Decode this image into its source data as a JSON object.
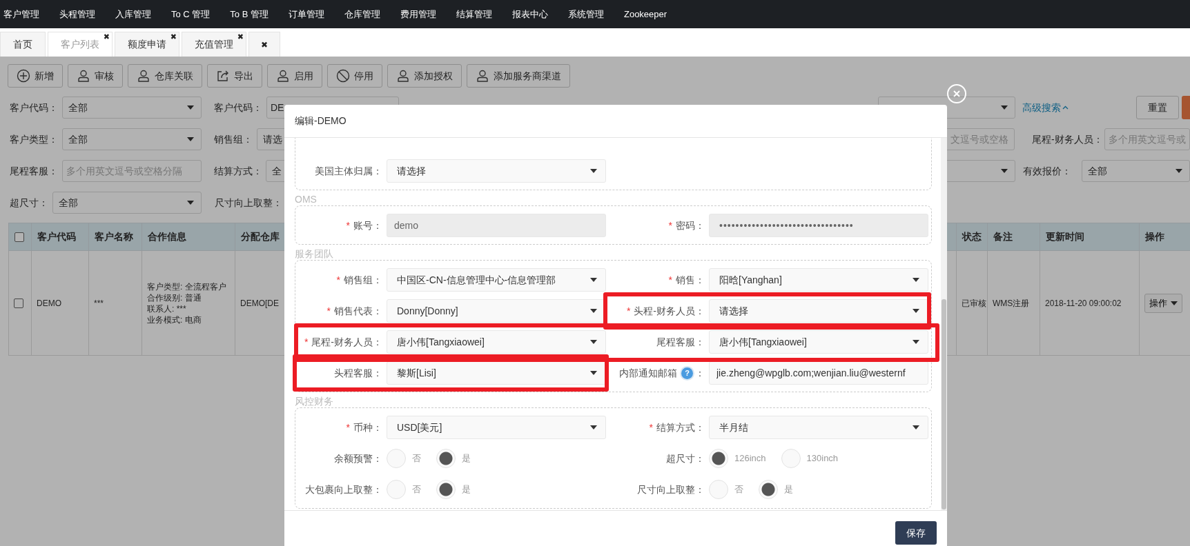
{
  "nav": {
    "items": [
      "客户管理",
      "头程管理",
      "入库管理",
      "To C 管理",
      "To B 管理",
      "订单管理",
      "仓库管理",
      "费用管理",
      "结算管理",
      "报表中心",
      "系统管理",
      "Zookeeper"
    ]
  },
  "tabs": [
    {
      "label": "首页",
      "selected": false
    },
    {
      "label": "客户列表",
      "selected": true,
      "close": "✖"
    },
    {
      "label": "额度申请",
      "selected": false,
      "close": "✖"
    },
    {
      "label": "充值管理",
      "selected": false,
      "close": "✖"
    },
    {
      "close": "✖",
      "selected": false
    }
  ],
  "toolbar": [
    {
      "kind": "add",
      "label": "新增"
    },
    {
      "kind": "approve",
      "label": "审核"
    },
    {
      "kind": "link",
      "label": "仓库关联"
    },
    {
      "kind": "export",
      "label": "导出"
    },
    {
      "kind": "enable",
      "label": "启用"
    },
    {
      "kind": "disable",
      "label": "停用"
    },
    {
      "kind": "authorize",
      "label": "添加授权"
    },
    {
      "kind": "channel",
      "label": "添加服务商渠道"
    }
  ],
  "filters": [
    {
      "left": [
        {
          "kind": "label",
          "text": "客户代码："
        },
        {
          "kind": "select",
          "value": "全部"
        },
        {
          "kind": "label",
          "text": "客户代码："
        },
        {
          "kind": "input",
          "value": "DE"
        }
      ],
      "right": [
        {
          "kind": "select"
        },
        {
          "kind": "link",
          "text": "高级搜索"
        },
        {
          "kind": "button",
          "label": "重置"
        },
        {
          "kind": "primary"
        }
      ]
    },
    {
      "left": [
        {
          "kind": "label",
          "text": "客户类型："
        },
        {
          "kind": "select",
          "value": "全部"
        },
        {
          "kind": "label",
          "text": "销售组："
        },
        {
          "kind": "select",
          "value": "请选"
        }
      ],
      "right": [
        {
          "kind": "input",
          "placeholder": "文逗号或空格"
        },
        {
          "kind": "label",
          "text": "尾程-财务人员："
        },
        {
          "kind": "input",
          "placeholder": "多个用英文逗号或"
        }
      ]
    },
    {
      "left": [
        {
          "kind": "label",
          "text": "尾程客服："
        },
        {
          "kind": "input",
          "placeholder": "多个用英文逗号或空格分隔"
        },
        {
          "kind": "label",
          "text": "结算方式："
        },
        {
          "kind": "select",
          "value": "全"
        }
      ],
      "right": [
        {
          "kind": "select"
        },
        {
          "kind": "label",
          "text": "有效报价："
        },
        {
          "kind": "select",
          "value": "全部"
        }
      ]
    },
    {
      "left": [
        {
          "kind": "label",
          "text": "超尺寸："
        },
        {
          "kind": "select",
          "value": "全部"
        },
        {
          "kind": "label",
          "text": "尺寸向上取整："
        }
      ]
    }
  ],
  "table": {
    "columns": [
      {
        "kind": "checkbox",
        "checked": false
      },
      {
        "kind": "text",
        "label": "客户代码"
      },
      {
        "kind": "text",
        "label": "客户名称"
      },
      {
        "kind": "text",
        "label": "合作信息"
      },
      {
        "kind": "text",
        "label": "分配仓库"
      },
      {
        "kind": "text",
        "label": "状态"
      },
      {
        "kind": "text",
        "label": "备注"
      },
      {
        "kind": "text",
        "label": "更新时间"
      },
      {
        "kind": "text",
        "label": "操作"
      }
    ],
    "rows": [
      {
        "cells": [
          {
            "kind": "checkbox",
            "checked": false
          },
          {
            "kind": "text",
            "text": "DEMO"
          },
          {
            "kind": "text",
            "text": "***"
          },
          {
            "kind": "lines",
            "lines": [
              "客户类型: 全流程客户",
              "合作级别: 普通",
              "联系人: ***",
              "业务模式: 电商"
            ]
          },
          {
            "kind": "text",
            "text": "DEMO[DE"
          },
          {
            "kind": "text",
            "text": "已审核"
          },
          {
            "kind": "text",
            "text": "WMS注册"
          },
          {
            "kind": "text",
            "text": "2018-11-20 09:00:02"
          },
          {
            "kind": "menu",
            "label": "操作"
          }
        ]
      }
    ]
  },
  "modal": {
    "title": "编辑-DEMO",
    "sections": [
      {
        "rows": [
          {
            "fields": [
              {
                "kind": "select",
                "label": "美国主体归属：",
                "value": "请选择"
              }
            ]
          }
        ]
      },
      {
        "legend": "OMS",
        "rows": [
          {
            "fields": [
              {
                "kind": "input",
                "required_mark": "*",
                "label": "账号：",
                "value": "demo",
                "disabled": true
              },
              {
                "kind": "password",
                "required_mark": "*",
                "label": "密码：",
                "value": "•••••••••••••••••••••••••••••••••",
                "disabled": true
              }
            ]
          }
        ]
      },
      {
        "legend": "服务团队",
        "rows": [
          {
            "highlighted": false,
            "fields": [
              {
                "kind": "select",
                "required_mark": "*",
                "label": "销售组：",
                "value": "中国区-CN-信息管理中心-信息管理部",
                "highlighted": false
              },
              {
                "kind": "select",
                "required_mark": "*",
                "label": "销售：",
                "value": "阳晗[Yanghan]",
                "highlighted": false
              }
            ]
          },
          {
            "highlighted": false,
            "fields": [
              {
                "kind": "select",
                "required_mark": "*",
                "label": "销售代表：",
                "value": "Donny[Donny]",
                "highlighted": false
              },
              {
                "kind": "select",
                "required_mark": "*",
                "label": "头程-财务人员：",
                "value": "请选择",
                "highlighted": true
              }
            ]
          },
          {
            "highlighted": true,
            "fields": [
              {
                "kind": "select",
                "required_mark": "*",
                "label": "尾程-财务人员：",
                "value": "唐小伟[Tangxiaowei]",
                "highlighted": false
              },
              {
                "kind": "select",
                "label": "尾程客服：",
                "value": "唐小伟[Tangxiaowei]",
                "highlighted": false
              }
            ]
          },
          {
            "highlighted": false,
            "fields": [
              {
                "kind": "select",
                "label": "头程客服：",
                "value": "黎斯[Lisi]",
                "highlighted": true
              },
              {
                "kind": "input",
                "label": "内部通知邮箱",
                "help": "?",
                "label_suffix": "：",
                "value": "jie.zheng@wpglb.com;wenjian.liu@westernf",
                "highlighted": false
              }
            ]
          }
        ]
      },
      {
        "legend": "风控财务",
        "rows": [
          {
            "fields": [
              {
                "kind": "select",
                "required_mark": "*",
                "label": "币种：",
                "value": "USD[美元]"
              },
              {
                "kind": "select",
                "required_mark": "*",
                "label": "结算方式：",
                "value": "半月结"
              }
            ]
          },
          {
            "fields": [
              {
                "kind": "radio",
                "label": "余额预警：",
                "options": [
                  {
                    "label": "否",
                    "selected": false
                  },
                  {
                    "label": "是",
                    "selected": true
                  }
                ]
              },
              {
                "kind": "radio",
                "label": "超尺寸：",
                "options": [
                  {
                    "label": "126inch",
                    "selected": true
                  },
                  {
                    "label": "130inch",
                    "selected": false
                  }
                ]
              }
            ]
          },
          {
            "fields": [
              {
                "kind": "radio",
                "label": "大包裹向上取整：",
                "options": [
                  {
                    "label": "否",
                    "selected": false
                  },
                  {
                    "label": "是",
                    "selected": true
                  }
                ]
              },
              {
                "kind": "radio",
                "label": "尺寸向上取整：",
                "options": [
                  {
                    "label": "否",
                    "selected": false
                  },
                  {
                    "label": "是",
                    "selected": true
                  }
                ]
              }
            ]
          }
        ]
      }
    ],
    "save": "保存"
  }
}
